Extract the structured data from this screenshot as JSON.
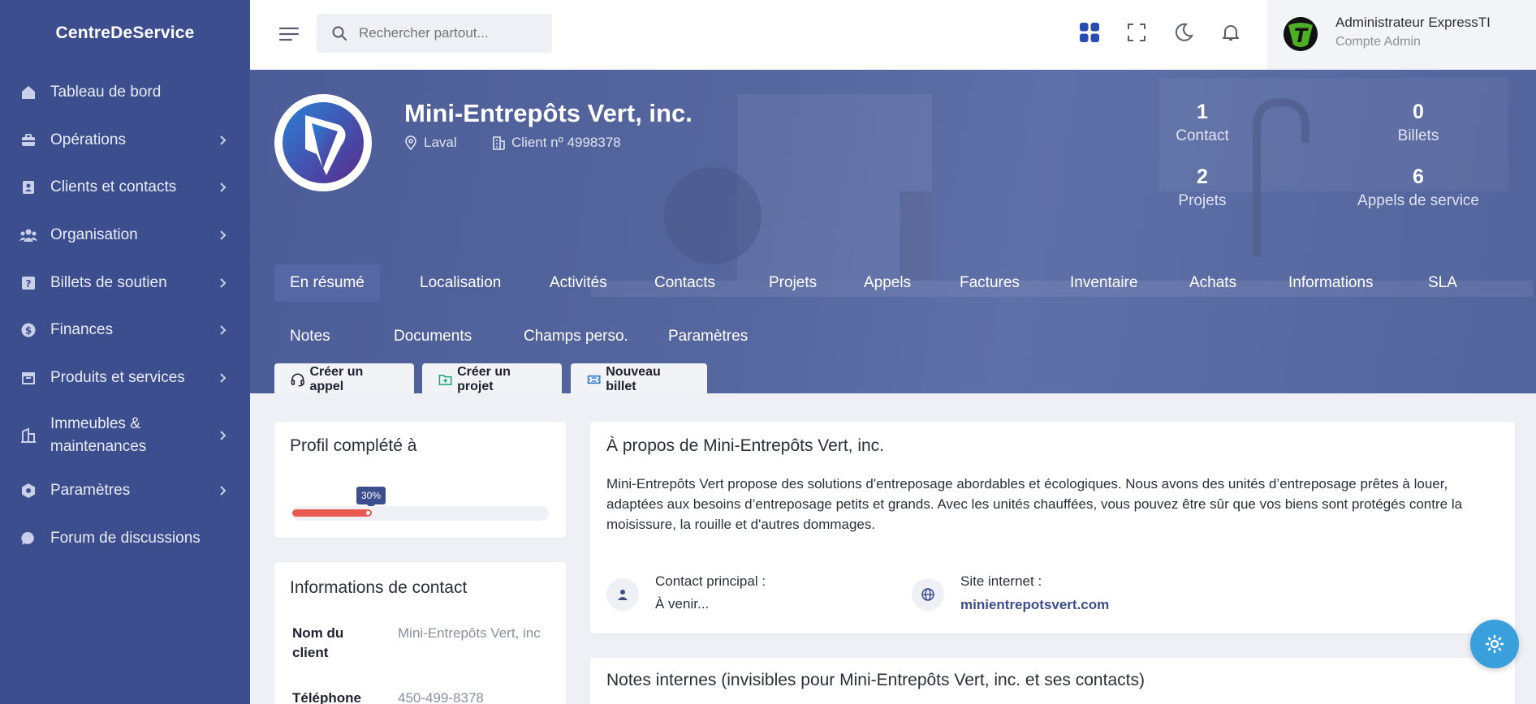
{
  "brand": "CentreDeService",
  "sidebar": {
    "items": [
      {
        "label": "Tableau de bord",
        "icon": "home-icon",
        "has_children": false
      },
      {
        "label": "Opérations",
        "icon": "briefcase-icon",
        "has_children": true
      },
      {
        "label": "Clients et contacts",
        "icon": "contact-card-icon",
        "has_children": true
      },
      {
        "label": "Organisation",
        "icon": "users-icon",
        "has_children": true
      },
      {
        "label": "Billets de soutien",
        "icon": "help-ticket-icon",
        "has_children": true
      },
      {
        "label": "Finances",
        "icon": "dollar-coin-icon",
        "has_children": true
      },
      {
        "label": "Produits et services",
        "icon": "box-icon",
        "has_children": true
      },
      {
        "label": "Immeubles & maintenances",
        "icon": "building-icon",
        "has_children": true
      },
      {
        "label": "Paramètres",
        "icon": "settings-hexagon-icon",
        "has_children": true
      },
      {
        "label": "Forum de discussions",
        "icon": "chat-bubble-icon",
        "has_children": false
      }
    ]
  },
  "header": {
    "search_placeholder": "Rechercher partout...",
    "user_name": "Administrateur ExpressTI",
    "user_role": "Compte Admin",
    "avatar_letter": "T"
  },
  "client": {
    "name": "Mini-Entrepôts Vert, inc.",
    "city": "Laval",
    "client_number": "Client nº 4998378",
    "stats": [
      {
        "value": "1",
        "label": "Contact"
      },
      {
        "value": "0",
        "label": "Billets"
      },
      {
        "value": "2",
        "label": "Projets"
      },
      {
        "value": "6",
        "label": "Appels de service"
      }
    ]
  },
  "tabs": {
    "row1": [
      "En résumé",
      "Localisation",
      "Activités",
      "Contacts",
      "Projets",
      "Appels",
      "Factures",
      "Inventaire",
      "Achats",
      "Informations",
      "SLA"
    ],
    "row2": [
      "Notes",
      "Documents",
      "Champs perso.",
      "Paramètres"
    ],
    "active": "En résumé"
  },
  "actions": {
    "create_call": "Créer un appel",
    "create_project": "Créer un projet",
    "new_ticket": "Nouveau billet"
  },
  "profile": {
    "title": "Profil complété à",
    "percent_label": "30%",
    "percent": 30
  },
  "contact_info": {
    "title": "Informations de contact",
    "client_name_label": "Nom du client",
    "client_name_value": "Mini-Entrepôts Vert, inc",
    "phone_label": "Téléphone",
    "phone_value": "450-499-8378"
  },
  "about": {
    "title": "À propos de Mini-Entrepôts Vert, inc.",
    "text": "Mini-Entrepôts Vert propose des solutions d'entreposage abordables et écologiques. Nous avons des unités d’entreposage prêtes à louer, adaptées aux besoins d’entreposage petits et grands. Avec les unités chauffées, vous pouvez être sûr que vos biens sont protégés contre la moisissure, la rouille et d'autres dommages.",
    "main_contact_label": "Contact principal :",
    "main_contact_value": "À venir...",
    "website_label": "Site internet :",
    "website_value": "minientrepotsvert.com"
  },
  "notes": {
    "title": "Notes internes (invisibles pour Mini-Entrepôts Vert, inc. et ses contacts)"
  },
  "colors": {
    "sidebar": "#3d4e8e",
    "accent": "#3d4e8e",
    "progress": "#e85a4f",
    "fab": "#3aa0dc",
    "grid_icon": "#2a4cb0"
  }
}
